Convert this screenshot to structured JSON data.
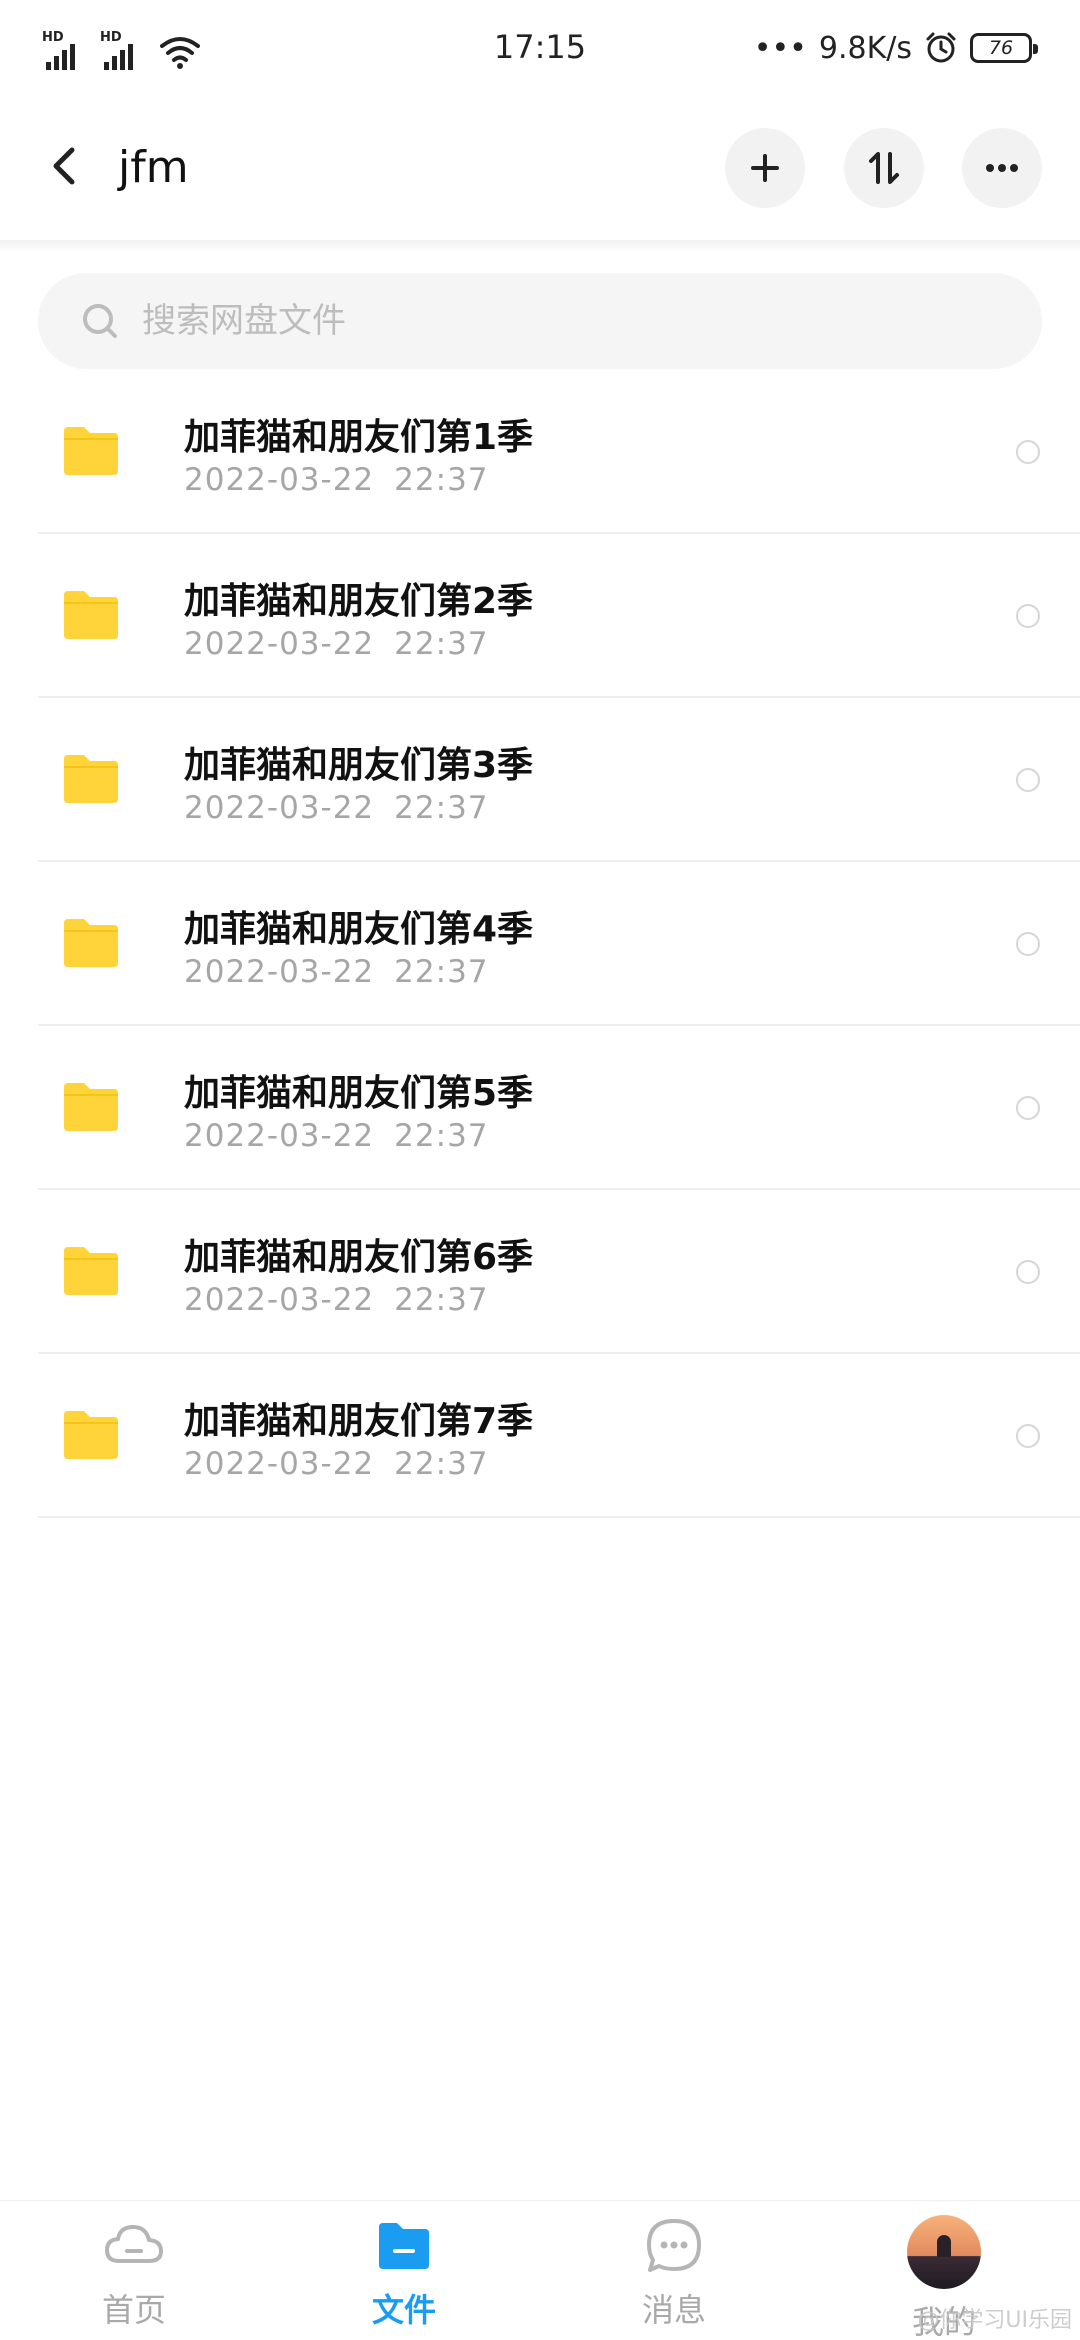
{
  "status_bar": {
    "time": "17:15",
    "signal1_label": "HD",
    "signal2_label": "HD",
    "dots": "•••",
    "network_speed": "9.8K/s",
    "battery": "76"
  },
  "header": {
    "title": "jfm",
    "add_icon": "plus-icon",
    "sort_icon": "sort-icon",
    "more_icon": "more-icon"
  },
  "search": {
    "placeholder": "搜索网盘文件"
  },
  "files": [
    {
      "name": "加菲猫和朋友们第1季",
      "date": "2022-03-22",
      "time": "22:37"
    },
    {
      "name": "加菲猫和朋友们第2季",
      "date": "2022-03-22",
      "time": "22:37"
    },
    {
      "name": "加菲猫和朋友们第3季",
      "date": "2022-03-22",
      "time": "22:37"
    },
    {
      "name": "加菲猫和朋友们第4季",
      "date": "2022-03-22",
      "time": "22:37"
    },
    {
      "name": "加菲猫和朋友们第5季",
      "date": "2022-03-22",
      "time": "22:37"
    },
    {
      "name": "加菲猫和朋友们第6季",
      "date": "2022-03-22",
      "time": "22:37"
    },
    {
      "name": "加菲猫和朋友们第7季",
      "date": "2022-03-22",
      "time": "22:37"
    }
  ],
  "bottom_nav": {
    "home": "首页",
    "files": "文件",
    "messages": "消息",
    "mine": "我的"
  },
  "colors": {
    "accent": "#1a9cf0",
    "folder": "#ffd43b"
  },
  "watermark": "@你学习UI乐园"
}
